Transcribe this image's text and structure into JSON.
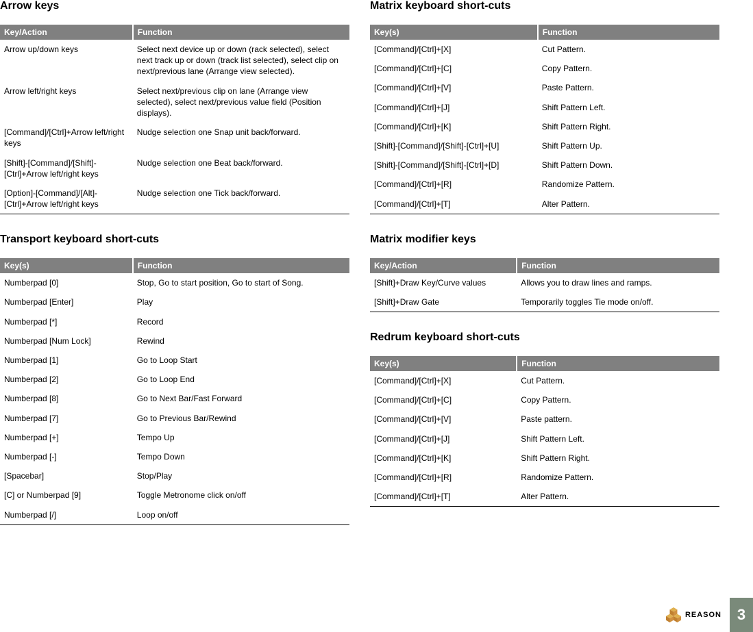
{
  "left": {
    "sections": [
      {
        "title": "Arrow keys",
        "headers": [
          "Key/Action",
          "Function"
        ],
        "rows": [
          {
            "key": "Arrow  up/down keys",
            "func": "Select next device up or down (rack selected), select next track up or down (track list selected), select clip on next/previous lane (Arrange view selected)."
          },
          {
            "key": "Arrow  left/right keys",
            "func": "Select next/previous clip on lane (Arrange view selected), select next/previous value field (Position displays)."
          },
          {
            "key": "[Command]/[Ctrl]+Arrow left/right keys",
            "func": "Nudge selection one Snap unit back/forward."
          },
          {
            "key": "[Shift]-[Command]/[Shift]-[Ctrl]+Arrow left/right keys",
            "func": "Nudge selection one Beat back/forward."
          },
          {
            "key": "[Option]-[Command]/[Alt]-[Ctrl]+Arrow left/right keys",
            "func": "Nudge selection one Tick back/forward."
          }
        ]
      },
      {
        "title": "Transport keyboard short-cuts",
        "headers": [
          "Key(s)",
          "Function"
        ],
        "rows": [
          {
            "key": "Numberpad [0]",
            "func": "Stop, Go to start position, Go to start of Song."
          },
          {
            "key": "Numberpad [Enter]",
            "func": "Play"
          },
          {
            "key": "Numberpad [*]",
            "func": "Record"
          },
          {
            "key": "Numberpad [Num Lock]",
            "func": "Rewind"
          },
          {
            "key": "Numberpad [1]",
            "func": "Go to Loop Start"
          },
          {
            "key": "Numberpad [2]",
            "func": "Go to Loop End"
          },
          {
            "key": "Numberpad [8]",
            "func": "Go to Next Bar/Fast Forward"
          },
          {
            "key": "Numberpad [7]",
            "func": "Go to Previous Bar/Rewind"
          },
          {
            "key": "Numberpad [+]",
            "func": "Tempo Up"
          },
          {
            "key": "Numberpad [-]",
            "func": "Tempo Down"
          },
          {
            "key": "[Spacebar]",
            "func": "Stop/Play"
          },
          {
            "key": "[C] or Numberpad [9]",
            "func": "Toggle Metronome click on/off"
          },
          {
            "key": "Numberpad [/]",
            "func": "Loop on/off"
          }
        ]
      }
    ]
  },
  "right": {
    "sections": [
      {
        "title": "Matrix keyboard short-cuts",
        "headers": [
          "Key(s)",
          "Function"
        ],
        "rows": [
          {
            "key": "[Command]/[Ctrl]+[X]",
            "func": "Cut Pattern."
          },
          {
            "key": "[Command]/[Ctrl]+[C]",
            "func": "Copy Pattern."
          },
          {
            "key": "[Command]/[Ctrl]+[V]",
            "func": "Paste Pattern."
          },
          {
            "key": "[Command]/[Ctrl]+[J]",
            "func": "Shift Pattern Left."
          },
          {
            "key": "[Command]/[Ctrl]+[K]",
            "func": "Shift Pattern Right."
          },
          {
            "key": "[Shift]-[Command]/[Shift]-[Ctrl]+[U]",
            "func": "Shift Pattern Up."
          },
          {
            "key": "[Shift]-[Command]/[Shift]-[Ctrl]+[D]",
            "func": "Shift Pattern Down."
          },
          {
            "key": "[Command]/[Ctrl]+[R]",
            "func": "Randomize Pattern."
          },
          {
            "key": "[Command]/[Ctrl]+[T]",
            "func": "Alter Pattern."
          }
        ]
      },
      {
        "title": "Matrix modifier keys",
        "headers": [
          "Key/Action",
          "Function"
        ],
        "rows": [
          {
            "key": "[Shift]+Draw Key/Curve values",
            "func": "Allows you to draw lines and ramps."
          },
          {
            "key": "[Shift]+Draw Gate",
            "func": "Temporarily toggles Tie mode on/off."
          }
        ]
      },
      {
        "title": "Redrum keyboard short-cuts",
        "headers": [
          "Key(s)",
          "Function"
        ],
        "rows": [
          {
            "key": "[Command]/[Ctrl]+[X]",
            "func": "Cut Pattern."
          },
          {
            "key": "[Command]/[Ctrl]+[C]",
            "func": "Copy Pattern."
          },
          {
            "key": "[Command]/[Ctrl]+[V]",
            "func": "Paste pattern."
          },
          {
            "key": "[Command]/[Ctrl]+[J]",
            "func": "Shift Pattern Left."
          },
          {
            "key": "[Command]/[Ctrl]+[K]",
            "func": "Shift Pattern Right."
          },
          {
            "key": "[Command]/[Ctrl]+[R]",
            "func": "Randomize Pattern."
          },
          {
            "key": "[Command]/[Ctrl]+[T]",
            "func": "Alter Pattern."
          }
        ]
      }
    ]
  },
  "footer": {
    "brand": "REASON",
    "page": "3"
  }
}
